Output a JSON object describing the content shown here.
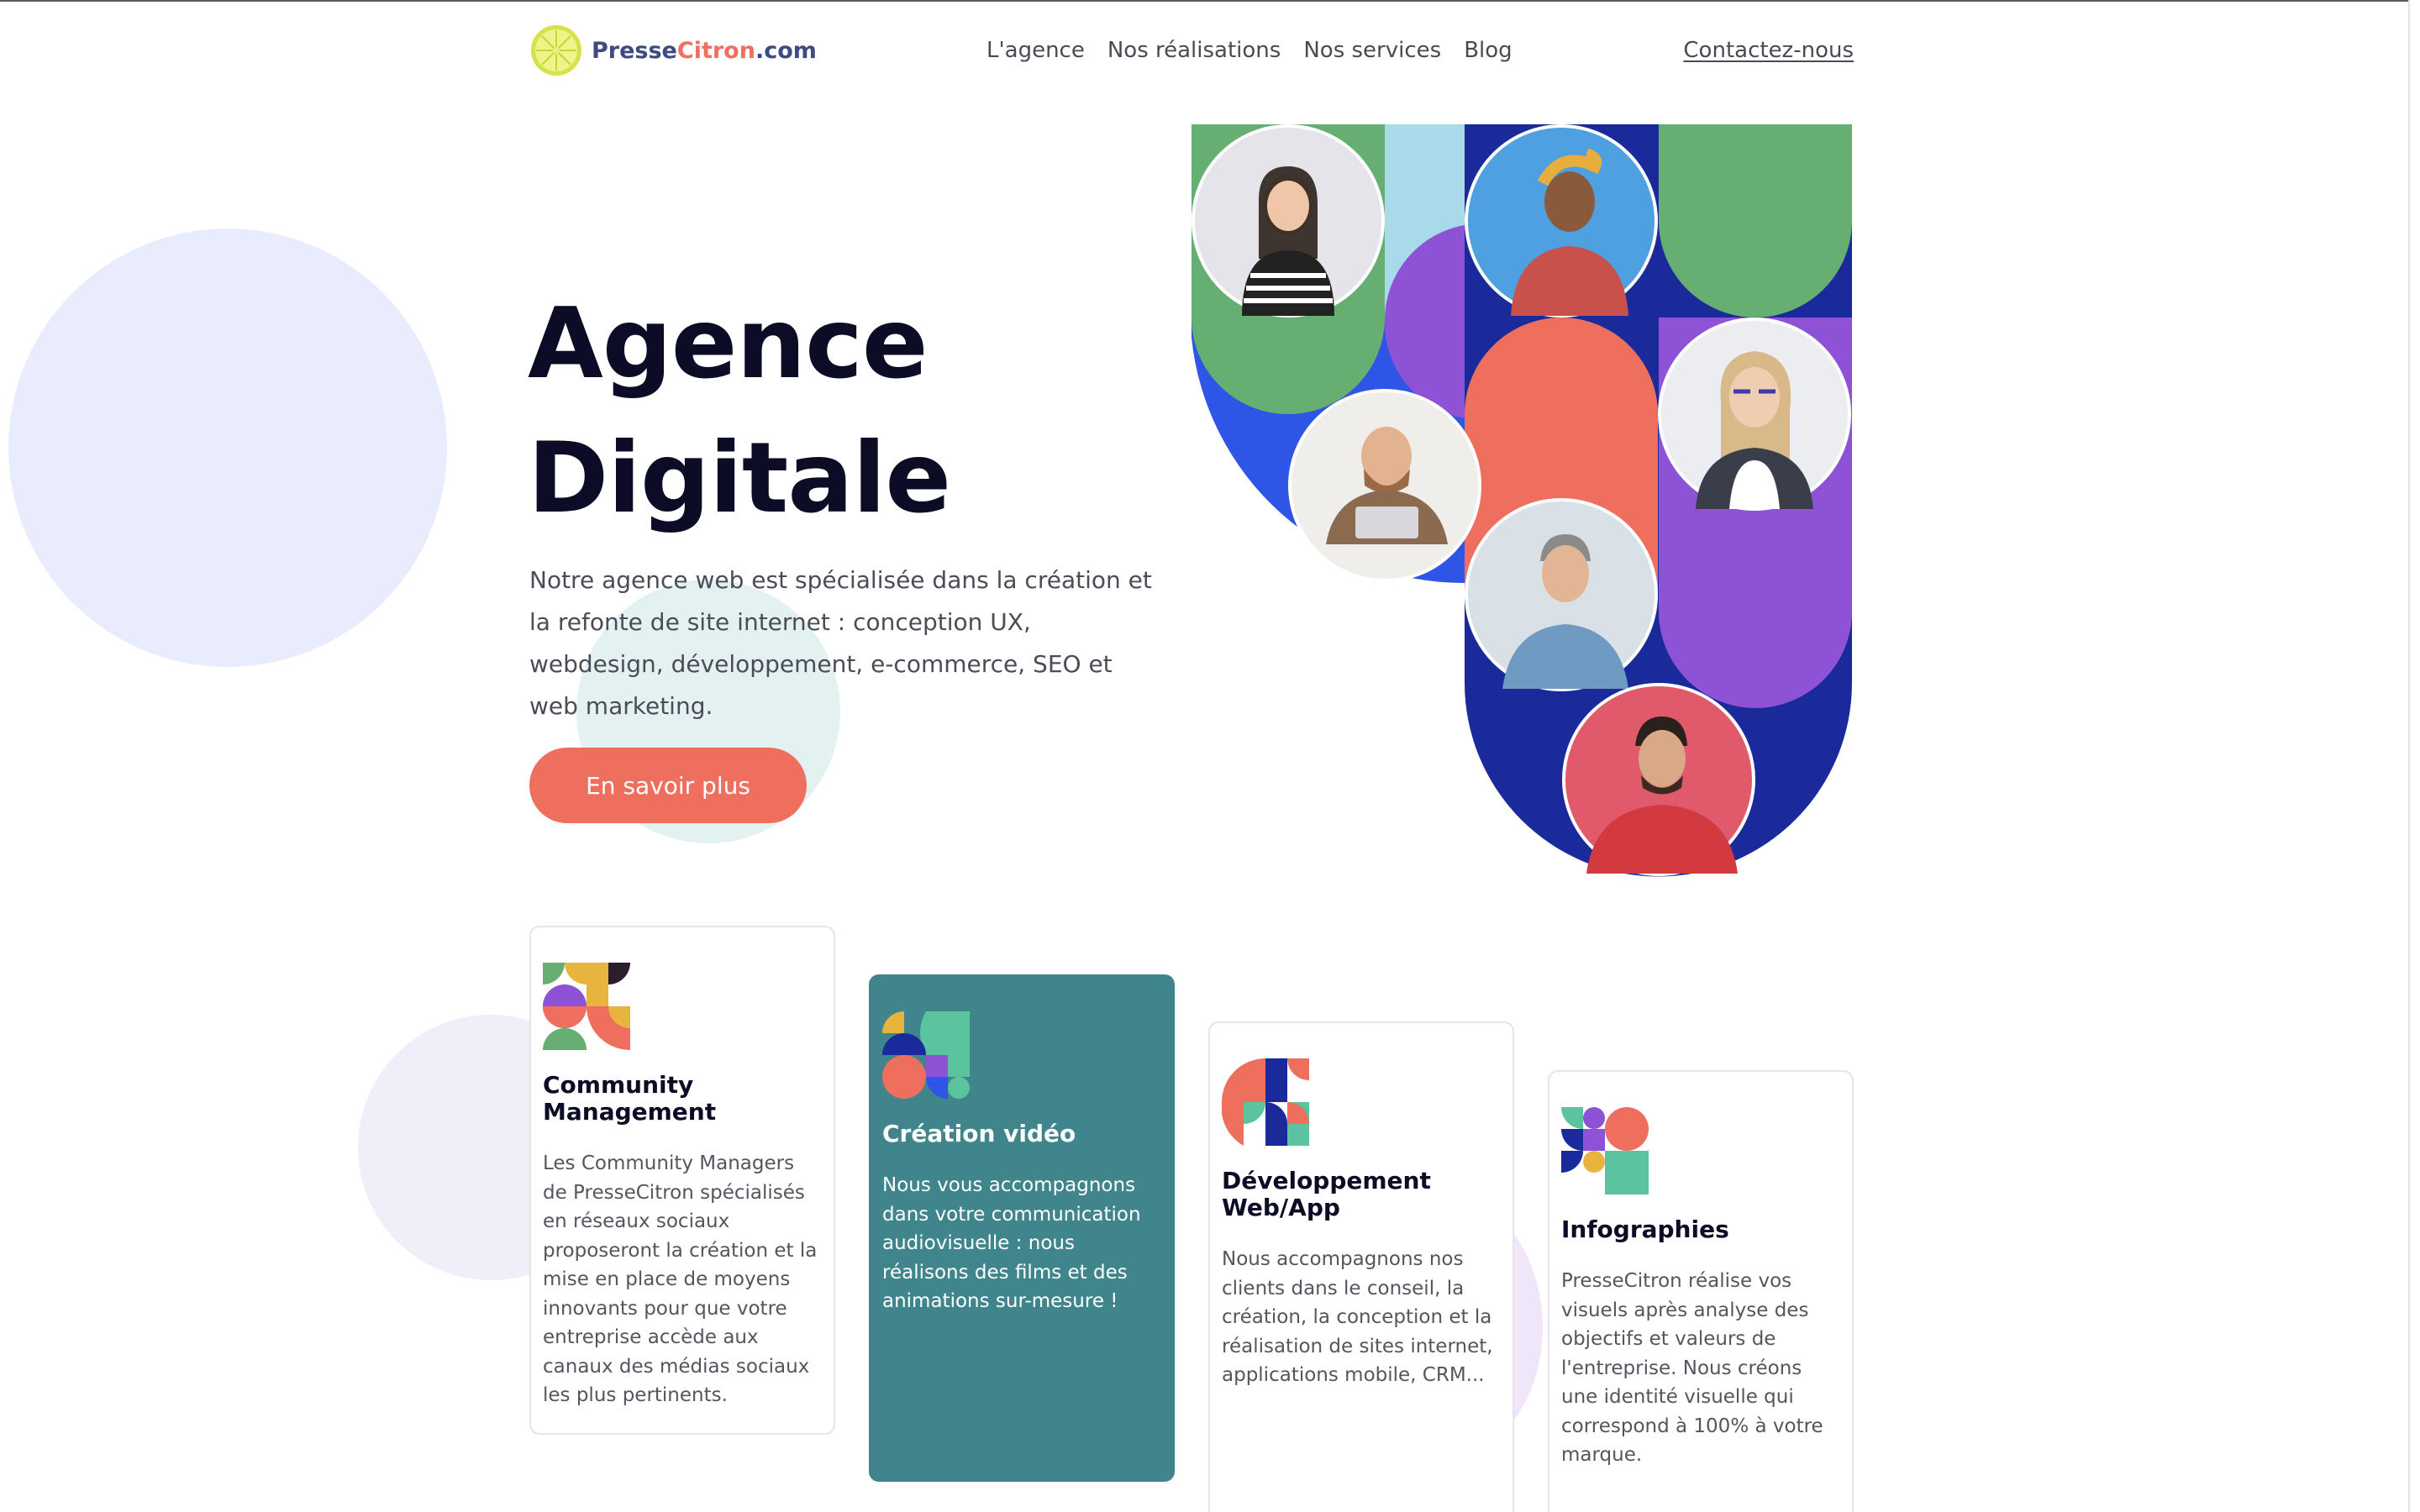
{
  "logo": {
    "part1": "Presse",
    "part2": "Citron",
    "part3": ".com"
  },
  "nav": {
    "items": [
      {
        "label": "L'agence"
      },
      {
        "label": "Nos réalisations"
      },
      {
        "label": "Nos services"
      },
      {
        "label": "Blog"
      }
    ],
    "contact": "Contactez-nous"
  },
  "hero": {
    "title_line1": "Agence",
    "title_line2": "Digitale",
    "description": "Notre agence web est spécialisée dans la création et la refonte de site internet : conception UX, webdesign, développement, e-commerce, SEO et web marketing.",
    "cta": "En savoir plus"
  },
  "cards": [
    {
      "title": "Community Management",
      "text": "Les Community Managers de PresseCitron spécialisés en réseaux sociaux proposeront la création et la mise en place de moyens innovants pour que votre entreprise accède aux canaux des médias sociaux les plus pertinents."
    },
    {
      "title": "Création vidéo",
      "text": "Nous vous accompagnons dans votre communication audiovisuelle : nous réalisons des films et des animations sur-mesure !"
    },
    {
      "title": "Développement Web/App",
      "text": "Nous accompagnons nos clients dans le conseil, la création, la conception et la réalisation de sites internet, applications mobile, CRM..."
    },
    {
      "title": "Infographies",
      "text": "PresseCitron réalise vos visuels après analyse des objectifs et valeurs de l'entreprise. Nous créons une identité visuelle qui correspond à 100% à votre marque."
    }
  ],
  "colors": {
    "accent_coral": "#ee6f5e",
    "teal_card": "#41858c",
    "green": "#66ae72",
    "blue": "#2f55e6",
    "navy": "#1a2a9a",
    "purple": "#8d52d6",
    "light_blue": "#a8daea",
    "yellow": "#e9b43d"
  },
  "icons": [
    "lemon-logo-icon",
    "community-icon",
    "video-icon",
    "dev-icon",
    "infographic-icon"
  ]
}
